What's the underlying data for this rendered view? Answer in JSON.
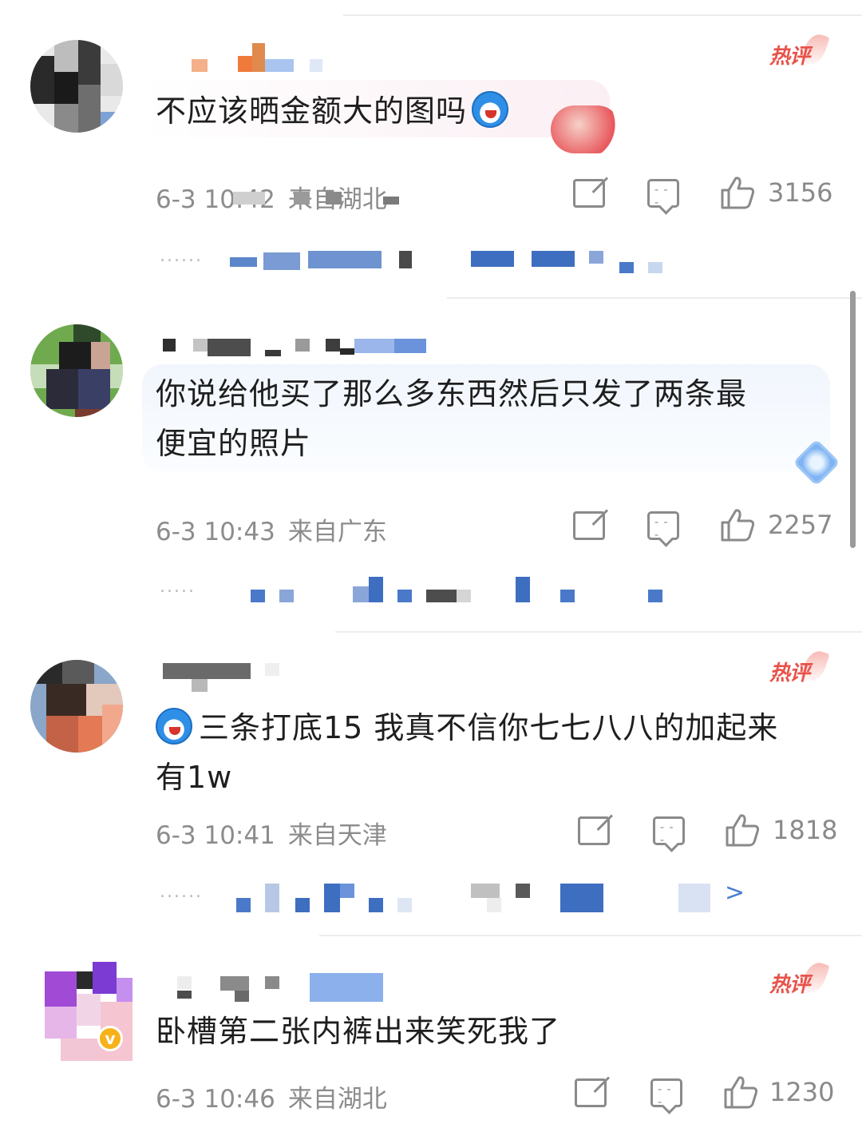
{
  "hot_label": "热评",
  "comments": [
    {
      "text": "不应该晒金额大的图吗",
      "has_emoji_end": true,
      "time": "6-3 10:42",
      "location": "来自湖北",
      "likes": "3156",
      "is_hot": true
    },
    {
      "text_line1": "你说给他买了那么多东西然后只发了两条最",
      "text_line2": "便宜的照片",
      "time": "6-3 10:43",
      "location": "来自广东",
      "likes": "2257",
      "is_hot": false
    },
    {
      "text_line1": "三条打底15 我真不信你七七八八的加起来",
      "text_line2": "有1w",
      "has_emoji_start": true,
      "time": "6-3 10:41",
      "location": "来自天津",
      "likes": "1818",
      "is_hot": true
    },
    {
      "text": "卧槽第二张内裤出来笑死我了",
      "time": "6-3 10:46",
      "location": "来自湖北",
      "likes": "1230",
      "is_hot": true
    }
  ],
  "reply_more": ">",
  "colors": {
    "hot": "#e8524a",
    "meta": "#8c8c8c",
    "text": "#1e1e1e",
    "link": "#4a7fd0"
  },
  "icons": [
    "share-icon",
    "comment-icon",
    "like-icon",
    "emoji-icon",
    "hot-badge-icon",
    "verified-v-icon"
  ]
}
